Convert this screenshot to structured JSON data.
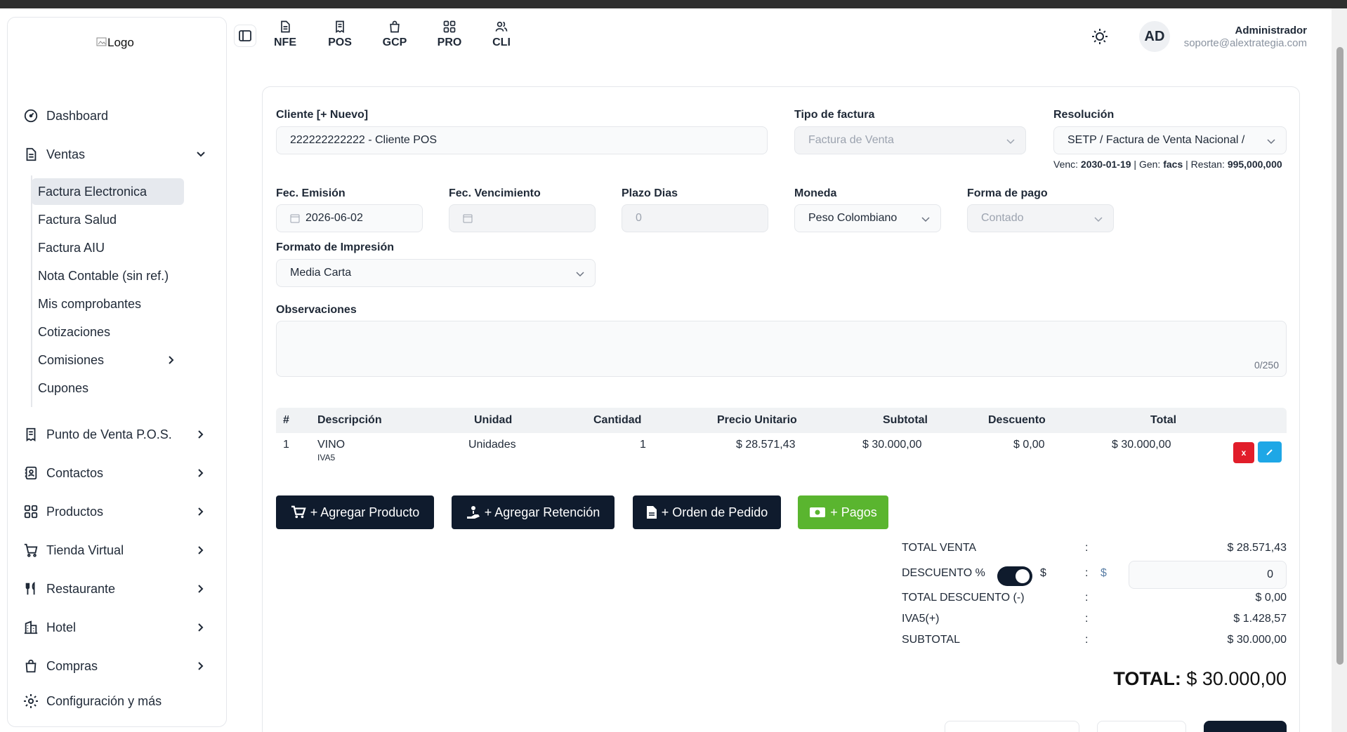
{
  "logo": {
    "alt": "Logo"
  },
  "header": {
    "modules": [
      {
        "label": "NFE",
        "icon": "document-icon"
      },
      {
        "label": "POS",
        "icon": "receipt-icon"
      },
      {
        "label": "GCP",
        "icon": "bag-icon"
      },
      {
        "label": "PRO",
        "icon": "grid-icon"
      },
      {
        "label": "CLI",
        "icon": "users-icon"
      }
    ],
    "user": {
      "initials": "AD",
      "name": "Administrador",
      "email": "soporte@alextrategia.com"
    }
  },
  "sidebar": {
    "items": [
      {
        "label": "Dashboard"
      },
      {
        "label": "Ventas"
      },
      {
        "label": "Punto de Venta P.O.S."
      },
      {
        "label": "Contactos"
      },
      {
        "label": "Productos"
      },
      {
        "label": "Tienda Virtual"
      },
      {
        "label": "Restaurante"
      },
      {
        "label": "Hotel"
      },
      {
        "label": "Compras"
      },
      {
        "label": "Configuración y más"
      }
    ],
    "ventas_sub": [
      {
        "label": "Factura Electronica"
      },
      {
        "label": "Factura Salud"
      },
      {
        "label": "Factura AIU"
      },
      {
        "label": "Nota Contable (sin ref.)"
      },
      {
        "label": "Mis comprobantes"
      },
      {
        "label": "Cotizaciones"
      },
      {
        "label": "Comisiones"
      },
      {
        "label": "Cupones"
      }
    ]
  },
  "form": {
    "cliente_label": "Cliente [+ Nuevo]",
    "cliente_value": "222222222222 - Cliente POS",
    "tipo_label": "Tipo de factura",
    "tipo_value": "Factura de Venta",
    "resolucion_label": "Resolución",
    "resolucion_value": "SETP / Factura de Venta Nacional /",
    "res_info": {
      "venc_label": "Venc:",
      "venc": "2030-01-19",
      "gen_label": "Gen:",
      "gen": "facs",
      "restan_label": "Restan:",
      "restan": "995,000,000"
    },
    "emision_label": "Fec. Emisión",
    "emision_value": "2026-06-02",
    "vencimiento_label": "Fec. Vencimiento",
    "vencimiento_value": "",
    "plazo_label": "Plazo Dias",
    "plazo_value": "0",
    "moneda_label": "Moneda",
    "moneda_value": "Peso Colombiano",
    "forma_label": "Forma de pago",
    "forma_value": "Contado",
    "formato_label": "Formato de Impresión",
    "formato_value": "Media Carta",
    "obs_label": "Observaciones",
    "obs_counter": "0/250"
  },
  "table": {
    "headers": [
      "#",
      "Descripción",
      "Unidad",
      "Cantidad",
      "Precio Unitario",
      "Subtotal",
      "Descuento",
      "Total"
    ],
    "rows": [
      {
        "num": "1",
        "desc": "VINO",
        "tax": "IVA5",
        "unidad": "Unidades",
        "cantidad": "1",
        "precio": "$ 28.571,43",
        "subtotal": "$ 30.000,00",
        "descuento": "$ 0,00",
        "total": "$ 30.000,00",
        "delete_label": "x"
      }
    ]
  },
  "actions": {
    "agregar_producto": "+ Agregar Producto",
    "agregar_retencion": "+ Agregar Retención",
    "orden_pedido": "+ Orden de Pedido",
    "pagos": "+ Pagos"
  },
  "totals": {
    "colon": ":",
    "total_venta_label": "TOTAL VENTA",
    "total_venta": "$ 28.571,43",
    "descuento_label": "DESCUENTO %",
    "descuento_dollar": "$",
    "descuento_currency": "$",
    "descuento_value": "0",
    "total_descuento_label": "TOTAL DESCUENTO (-)",
    "total_descuento": "$ 0,00",
    "iva_label": "IVA5(+)",
    "iva": "$ 1.428,57",
    "subtotal_label": "SUBTOTAL",
    "subtotal": "$ 30.000,00",
    "grand_label": "TOTAL:",
    "grand_value": "$ 30.000,00"
  },
  "colors": {
    "dark_button": "#0f1b2d",
    "green_button": "#5ab52f",
    "delete_red": "#e11d2a",
    "edit_blue": "#1ea7e6"
  }
}
